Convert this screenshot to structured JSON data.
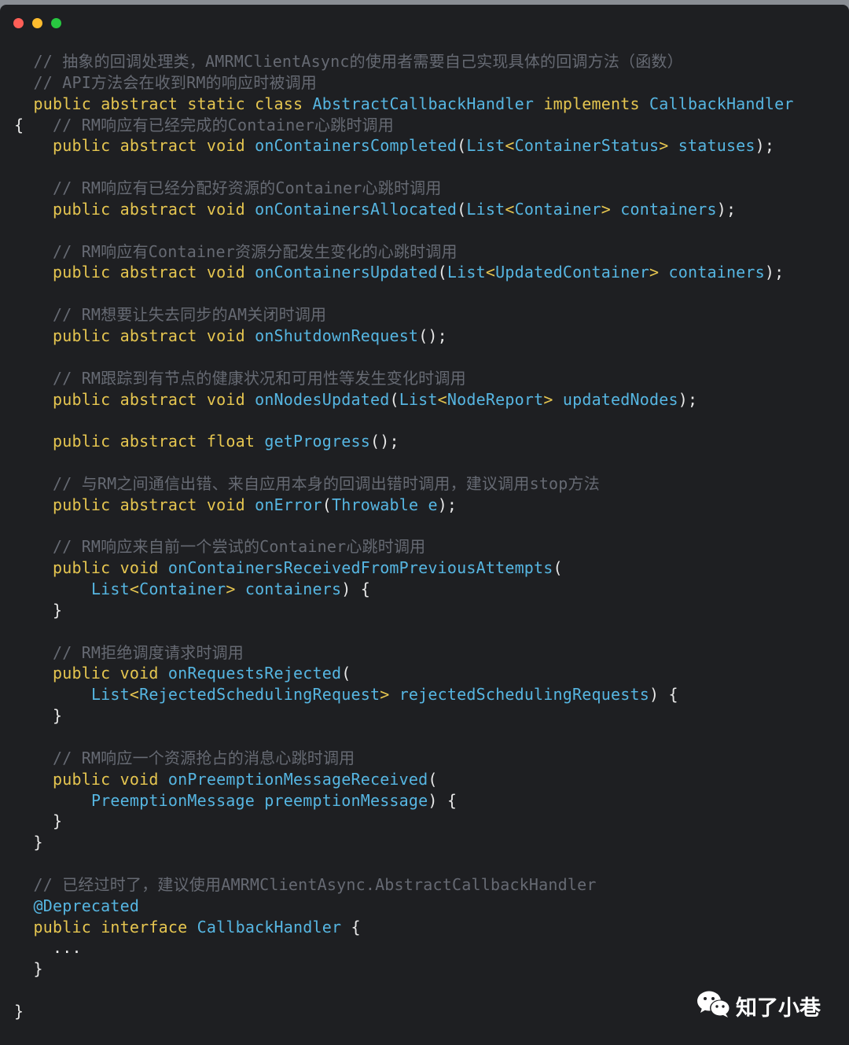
{
  "window": {
    "controls": [
      {
        "name": "close",
        "color": "#ff5f57"
      },
      {
        "name": "minimize",
        "color": "#febc2e"
      },
      {
        "name": "zoom",
        "color": "#28c840"
      }
    ]
  },
  "code": {
    "lines": [
      [
        [
          "  ",
          "pu"
        ],
        [
          "// 抽象的回调处理类，AMRMClientAsync的使用者需要自己实现具体的回调方法（函数）",
          "cm"
        ]
      ],
      [
        [
          "  ",
          "pu"
        ],
        [
          "// API方法会在收到RM的响应时被调用",
          "cm"
        ]
      ],
      [
        [
          "  ",
          "pu"
        ],
        [
          "public",
          "kw"
        ],
        [
          " ",
          "pu"
        ],
        [
          "abstract",
          "kw"
        ],
        [
          " ",
          "pu"
        ],
        [
          "static",
          "kw"
        ],
        [
          " ",
          "pu"
        ],
        [
          "class",
          "kw"
        ],
        [
          " ",
          "pu"
        ],
        [
          "AbstractCallbackHandler",
          "ty"
        ],
        [
          " ",
          "pu"
        ],
        [
          "implements",
          "kw"
        ],
        [
          " ",
          "pu"
        ],
        [
          "CallbackHandler",
          "ty"
        ]
      ],
      [
        [
          "{   ",
          "pu"
        ],
        [
          "// RM响应有已经完成的Container心跳时调用",
          "cm"
        ]
      ],
      [
        [
          "    ",
          "pu"
        ],
        [
          "public",
          "kw"
        ],
        [
          " ",
          "pu"
        ],
        [
          "abstract",
          "kw"
        ],
        [
          " ",
          "pu"
        ],
        [
          "void",
          "kw"
        ],
        [
          " ",
          "pu"
        ],
        [
          "onContainersCompleted",
          "fn"
        ],
        [
          "(",
          "pu"
        ],
        [
          "List",
          "ty"
        ],
        [
          "<",
          "kw"
        ],
        [
          "ContainerStatus",
          "ty"
        ],
        [
          ">",
          "kw"
        ],
        [
          " ",
          "pu"
        ],
        [
          "statuses",
          "id"
        ],
        [
          ");",
          "pu"
        ]
      ],
      [],
      [
        [
          "    ",
          "pu"
        ],
        [
          "// RM响应有已经分配好资源的Container心跳时调用",
          "cm"
        ]
      ],
      [
        [
          "    ",
          "pu"
        ],
        [
          "public",
          "kw"
        ],
        [
          " ",
          "pu"
        ],
        [
          "abstract",
          "kw"
        ],
        [
          " ",
          "pu"
        ],
        [
          "void",
          "kw"
        ],
        [
          " ",
          "pu"
        ],
        [
          "onContainersAllocated",
          "fn"
        ],
        [
          "(",
          "pu"
        ],
        [
          "List",
          "ty"
        ],
        [
          "<",
          "kw"
        ],
        [
          "Container",
          "ty"
        ],
        [
          ">",
          "kw"
        ],
        [
          " ",
          "pu"
        ],
        [
          "containers",
          "id"
        ],
        [
          ");",
          "pu"
        ]
      ],
      [],
      [
        [
          "    ",
          "pu"
        ],
        [
          "// RM响应有Container资源分配发生变化的心跳时调用",
          "cm"
        ]
      ],
      [
        [
          "    ",
          "pu"
        ],
        [
          "public",
          "kw"
        ],
        [
          " ",
          "pu"
        ],
        [
          "abstract",
          "kw"
        ],
        [
          " ",
          "pu"
        ],
        [
          "void",
          "kw"
        ],
        [
          " ",
          "pu"
        ],
        [
          "onContainersUpdated",
          "fn"
        ],
        [
          "(",
          "pu"
        ],
        [
          "List",
          "ty"
        ],
        [
          "<",
          "kw"
        ],
        [
          "UpdatedContainer",
          "ty"
        ],
        [
          ">",
          "kw"
        ],
        [
          " ",
          "pu"
        ],
        [
          "containers",
          "id"
        ],
        [
          ");",
          "pu"
        ]
      ],
      [],
      [
        [
          "    ",
          "pu"
        ],
        [
          "// RM想要让失去同步的AM关闭时调用",
          "cm"
        ]
      ],
      [
        [
          "    ",
          "pu"
        ],
        [
          "public",
          "kw"
        ],
        [
          " ",
          "pu"
        ],
        [
          "abstract",
          "kw"
        ],
        [
          " ",
          "pu"
        ],
        [
          "void",
          "kw"
        ],
        [
          " ",
          "pu"
        ],
        [
          "onShutdownRequest",
          "fn"
        ],
        [
          "();",
          "pu"
        ]
      ],
      [],
      [
        [
          "    ",
          "pu"
        ],
        [
          "// RM跟踪到有节点的健康状况和可用性等发生变化时调用",
          "cm"
        ]
      ],
      [
        [
          "    ",
          "pu"
        ],
        [
          "public",
          "kw"
        ],
        [
          " ",
          "pu"
        ],
        [
          "abstract",
          "kw"
        ],
        [
          " ",
          "pu"
        ],
        [
          "void",
          "kw"
        ],
        [
          " ",
          "pu"
        ],
        [
          "onNodesUpdated",
          "fn"
        ],
        [
          "(",
          "pu"
        ],
        [
          "List",
          "ty"
        ],
        [
          "<",
          "kw"
        ],
        [
          "NodeReport",
          "ty"
        ],
        [
          ">",
          "kw"
        ],
        [
          " ",
          "pu"
        ],
        [
          "updatedNodes",
          "id"
        ],
        [
          ");",
          "pu"
        ]
      ],
      [],
      [
        [
          "    ",
          "pu"
        ],
        [
          "public",
          "kw"
        ],
        [
          " ",
          "pu"
        ],
        [
          "abstract",
          "kw"
        ],
        [
          " ",
          "pu"
        ],
        [
          "float",
          "kw"
        ],
        [
          " ",
          "pu"
        ],
        [
          "getProgress",
          "fn"
        ],
        [
          "();",
          "pu"
        ]
      ],
      [],
      [
        [
          "    ",
          "pu"
        ],
        [
          "// 与RM之间通信出错、来自应用本身的回调出错时调用，建议调用stop方法",
          "cm"
        ]
      ],
      [
        [
          "    ",
          "pu"
        ],
        [
          "public",
          "kw"
        ],
        [
          " ",
          "pu"
        ],
        [
          "abstract",
          "kw"
        ],
        [
          " ",
          "pu"
        ],
        [
          "void",
          "kw"
        ],
        [
          " ",
          "pu"
        ],
        [
          "onError",
          "fn"
        ],
        [
          "(",
          "pu"
        ],
        [
          "Throwable",
          "ty"
        ],
        [
          " ",
          "pu"
        ],
        [
          "e",
          "id"
        ],
        [
          ");",
          "pu"
        ]
      ],
      [],
      [
        [
          "    ",
          "pu"
        ],
        [
          "// RM响应来自前一个尝试的Container心跳时调用",
          "cm"
        ]
      ],
      [
        [
          "    ",
          "pu"
        ],
        [
          "public",
          "kw"
        ],
        [
          " ",
          "pu"
        ],
        [
          "void",
          "kw"
        ],
        [
          " ",
          "pu"
        ],
        [
          "onContainersReceivedFromPreviousAttempts",
          "fn"
        ],
        [
          "(",
          "pu"
        ]
      ],
      [
        [
          "        ",
          "pu"
        ],
        [
          "List",
          "ty"
        ],
        [
          "<",
          "kw"
        ],
        [
          "Container",
          "ty"
        ],
        [
          ">",
          "kw"
        ],
        [
          " ",
          "pu"
        ],
        [
          "containers",
          "id"
        ],
        [
          ") {",
          "pu"
        ]
      ],
      [
        [
          "    }",
          "pu"
        ]
      ],
      [],
      [
        [
          "    ",
          "pu"
        ],
        [
          "// RM拒绝调度请求时调用",
          "cm"
        ]
      ],
      [
        [
          "    ",
          "pu"
        ],
        [
          "public",
          "kw"
        ],
        [
          " ",
          "pu"
        ],
        [
          "void",
          "kw"
        ],
        [
          " ",
          "pu"
        ],
        [
          "onRequestsRejected",
          "fn"
        ],
        [
          "(",
          "pu"
        ]
      ],
      [
        [
          "        ",
          "pu"
        ],
        [
          "List",
          "ty"
        ],
        [
          "<",
          "kw"
        ],
        [
          "RejectedSchedulingRequest",
          "ty"
        ],
        [
          ">",
          "kw"
        ],
        [
          " ",
          "pu"
        ],
        [
          "rejectedSchedulingRequests",
          "id"
        ],
        [
          ") {",
          "pu"
        ]
      ],
      [
        [
          "    }",
          "pu"
        ]
      ],
      [],
      [
        [
          "    ",
          "pu"
        ],
        [
          "// RM响应一个资源抢占的消息心跳时调用",
          "cm"
        ]
      ],
      [
        [
          "    ",
          "pu"
        ],
        [
          "public",
          "kw"
        ],
        [
          " ",
          "pu"
        ],
        [
          "void",
          "kw"
        ],
        [
          " ",
          "pu"
        ],
        [
          "onPreemptionMessageReceived",
          "fn"
        ],
        [
          "(",
          "pu"
        ]
      ],
      [
        [
          "        ",
          "pu"
        ],
        [
          "PreemptionMessage",
          "ty"
        ],
        [
          " ",
          "pu"
        ],
        [
          "preemptionMessage",
          "id"
        ],
        [
          ") {",
          "pu"
        ]
      ],
      [
        [
          "    }",
          "pu"
        ]
      ],
      [
        [
          "  }",
          "pu"
        ]
      ],
      [],
      [
        [
          "  ",
          "pu"
        ],
        [
          "// 已经过时了，建议使用AMRMClientAsync.AbstractCallbackHandler",
          "cm"
        ]
      ],
      [
        [
          "  ",
          "pu"
        ],
        [
          "@Deprecated",
          "an"
        ]
      ],
      [
        [
          "  ",
          "pu"
        ],
        [
          "public",
          "kw"
        ],
        [
          " ",
          "pu"
        ],
        [
          "interface",
          "kw"
        ],
        [
          " ",
          "pu"
        ],
        [
          "CallbackHandler",
          "ty"
        ],
        [
          " {",
          "pu"
        ]
      ],
      [
        [
          "    ...",
          "pu"
        ]
      ],
      [
        [
          "  }",
          "pu"
        ]
      ],
      [],
      [
        [
          "}",
          "pu"
        ]
      ]
    ]
  },
  "watermark": {
    "icon": "wechat-icon",
    "text": "知了小巷"
  }
}
